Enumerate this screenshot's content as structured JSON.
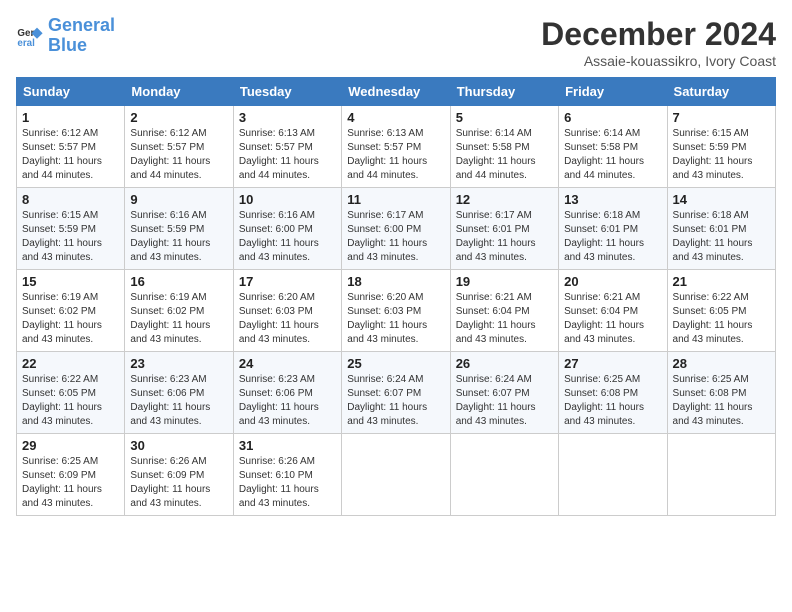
{
  "logo": {
    "line1": "General",
    "line2": "Blue"
  },
  "title": "December 2024",
  "subtitle": "Assaie-kouassikro, Ivory Coast",
  "headers": [
    "Sunday",
    "Monday",
    "Tuesday",
    "Wednesday",
    "Thursday",
    "Friday",
    "Saturday"
  ],
  "weeks": [
    [
      {
        "day": "1",
        "sunrise": "6:12 AM",
        "sunset": "5:57 PM",
        "daylight": "11 hours and 44 minutes."
      },
      {
        "day": "2",
        "sunrise": "6:12 AM",
        "sunset": "5:57 PM",
        "daylight": "11 hours and 44 minutes."
      },
      {
        "day": "3",
        "sunrise": "6:13 AM",
        "sunset": "5:57 PM",
        "daylight": "11 hours and 44 minutes."
      },
      {
        "day": "4",
        "sunrise": "6:13 AM",
        "sunset": "5:57 PM",
        "daylight": "11 hours and 44 minutes."
      },
      {
        "day": "5",
        "sunrise": "6:14 AM",
        "sunset": "5:58 PM",
        "daylight": "11 hours and 44 minutes."
      },
      {
        "day": "6",
        "sunrise": "6:14 AM",
        "sunset": "5:58 PM",
        "daylight": "11 hours and 44 minutes."
      },
      {
        "day": "7",
        "sunrise": "6:15 AM",
        "sunset": "5:59 PM",
        "daylight": "11 hours and 43 minutes."
      }
    ],
    [
      {
        "day": "8",
        "sunrise": "6:15 AM",
        "sunset": "5:59 PM",
        "daylight": "11 hours and 43 minutes."
      },
      {
        "day": "9",
        "sunrise": "6:16 AM",
        "sunset": "5:59 PM",
        "daylight": "11 hours and 43 minutes."
      },
      {
        "day": "10",
        "sunrise": "6:16 AM",
        "sunset": "6:00 PM",
        "daylight": "11 hours and 43 minutes."
      },
      {
        "day": "11",
        "sunrise": "6:17 AM",
        "sunset": "6:00 PM",
        "daylight": "11 hours and 43 minutes."
      },
      {
        "day": "12",
        "sunrise": "6:17 AM",
        "sunset": "6:01 PM",
        "daylight": "11 hours and 43 minutes."
      },
      {
        "day": "13",
        "sunrise": "6:18 AM",
        "sunset": "6:01 PM",
        "daylight": "11 hours and 43 minutes."
      },
      {
        "day": "14",
        "sunrise": "6:18 AM",
        "sunset": "6:01 PM",
        "daylight": "11 hours and 43 minutes."
      }
    ],
    [
      {
        "day": "15",
        "sunrise": "6:19 AM",
        "sunset": "6:02 PM",
        "daylight": "11 hours and 43 minutes."
      },
      {
        "day": "16",
        "sunrise": "6:19 AM",
        "sunset": "6:02 PM",
        "daylight": "11 hours and 43 minutes."
      },
      {
        "day": "17",
        "sunrise": "6:20 AM",
        "sunset": "6:03 PM",
        "daylight": "11 hours and 43 minutes."
      },
      {
        "day": "18",
        "sunrise": "6:20 AM",
        "sunset": "6:03 PM",
        "daylight": "11 hours and 43 minutes."
      },
      {
        "day": "19",
        "sunrise": "6:21 AM",
        "sunset": "6:04 PM",
        "daylight": "11 hours and 43 minutes."
      },
      {
        "day": "20",
        "sunrise": "6:21 AM",
        "sunset": "6:04 PM",
        "daylight": "11 hours and 43 minutes."
      },
      {
        "day": "21",
        "sunrise": "6:22 AM",
        "sunset": "6:05 PM",
        "daylight": "11 hours and 43 minutes."
      }
    ],
    [
      {
        "day": "22",
        "sunrise": "6:22 AM",
        "sunset": "6:05 PM",
        "daylight": "11 hours and 43 minutes."
      },
      {
        "day": "23",
        "sunrise": "6:23 AM",
        "sunset": "6:06 PM",
        "daylight": "11 hours and 43 minutes."
      },
      {
        "day": "24",
        "sunrise": "6:23 AM",
        "sunset": "6:06 PM",
        "daylight": "11 hours and 43 minutes."
      },
      {
        "day": "25",
        "sunrise": "6:24 AM",
        "sunset": "6:07 PM",
        "daylight": "11 hours and 43 minutes."
      },
      {
        "day": "26",
        "sunrise": "6:24 AM",
        "sunset": "6:07 PM",
        "daylight": "11 hours and 43 minutes."
      },
      {
        "day": "27",
        "sunrise": "6:25 AM",
        "sunset": "6:08 PM",
        "daylight": "11 hours and 43 minutes."
      },
      {
        "day": "28",
        "sunrise": "6:25 AM",
        "sunset": "6:08 PM",
        "daylight": "11 hours and 43 minutes."
      }
    ],
    [
      {
        "day": "29",
        "sunrise": "6:25 AM",
        "sunset": "6:09 PM",
        "daylight": "11 hours and 43 minutes."
      },
      {
        "day": "30",
        "sunrise": "6:26 AM",
        "sunset": "6:09 PM",
        "daylight": "11 hours and 43 minutes."
      },
      {
        "day": "31",
        "sunrise": "6:26 AM",
        "sunset": "6:10 PM",
        "daylight": "11 hours and 43 minutes."
      },
      null,
      null,
      null,
      null
    ]
  ]
}
